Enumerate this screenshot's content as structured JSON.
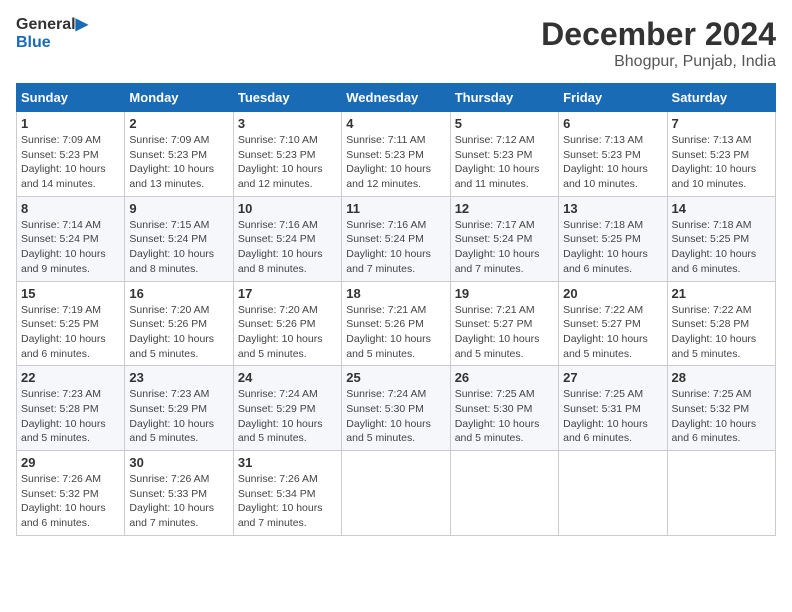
{
  "header": {
    "logo_line1": "General",
    "logo_line2": "Blue",
    "month": "December 2024",
    "location": "Bhogpur, Punjab, India"
  },
  "weekdays": [
    "Sunday",
    "Monday",
    "Tuesday",
    "Wednesday",
    "Thursday",
    "Friday",
    "Saturday"
  ],
  "weeks": [
    [
      {
        "day": "1",
        "sunrise": "Sunrise: 7:09 AM",
        "sunset": "Sunset: 5:23 PM",
        "daylight": "Daylight: 10 hours and 14 minutes."
      },
      {
        "day": "2",
        "sunrise": "Sunrise: 7:09 AM",
        "sunset": "Sunset: 5:23 PM",
        "daylight": "Daylight: 10 hours and 13 minutes."
      },
      {
        "day": "3",
        "sunrise": "Sunrise: 7:10 AM",
        "sunset": "Sunset: 5:23 PM",
        "daylight": "Daylight: 10 hours and 12 minutes."
      },
      {
        "day": "4",
        "sunrise": "Sunrise: 7:11 AM",
        "sunset": "Sunset: 5:23 PM",
        "daylight": "Daylight: 10 hours and 12 minutes."
      },
      {
        "day": "5",
        "sunrise": "Sunrise: 7:12 AM",
        "sunset": "Sunset: 5:23 PM",
        "daylight": "Daylight: 10 hours and 11 minutes."
      },
      {
        "day": "6",
        "sunrise": "Sunrise: 7:13 AM",
        "sunset": "Sunset: 5:23 PM",
        "daylight": "Daylight: 10 hours and 10 minutes."
      },
      {
        "day": "7",
        "sunrise": "Sunrise: 7:13 AM",
        "sunset": "Sunset: 5:23 PM",
        "daylight": "Daylight: 10 hours and 10 minutes."
      }
    ],
    [
      {
        "day": "8",
        "sunrise": "Sunrise: 7:14 AM",
        "sunset": "Sunset: 5:24 PM",
        "daylight": "Daylight: 10 hours and 9 minutes."
      },
      {
        "day": "9",
        "sunrise": "Sunrise: 7:15 AM",
        "sunset": "Sunset: 5:24 PM",
        "daylight": "Daylight: 10 hours and 8 minutes."
      },
      {
        "day": "10",
        "sunrise": "Sunrise: 7:16 AM",
        "sunset": "Sunset: 5:24 PM",
        "daylight": "Daylight: 10 hours and 8 minutes."
      },
      {
        "day": "11",
        "sunrise": "Sunrise: 7:16 AM",
        "sunset": "Sunset: 5:24 PM",
        "daylight": "Daylight: 10 hours and 7 minutes."
      },
      {
        "day": "12",
        "sunrise": "Sunrise: 7:17 AM",
        "sunset": "Sunset: 5:24 PM",
        "daylight": "Daylight: 10 hours and 7 minutes."
      },
      {
        "day": "13",
        "sunrise": "Sunrise: 7:18 AM",
        "sunset": "Sunset: 5:25 PM",
        "daylight": "Daylight: 10 hours and 6 minutes."
      },
      {
        "day": "14",
        "sunrise": "Sunrise: 7:18 AM",
        "sunset": "Sunset: 5:25 PM",
        "daylight": "Daylight: 10 hours and 6 minutes."
      }
    ],
    [
      {
        "day": "15",
        "sunrise": "Sunrise: 7:19 AM",
        "sunset": "Sunset: 5:25 PM",
        "daylight": "Daylight: 10 hours and 6 minutes."
      },
      {
        "day": "16",
        "sunrise": "Sunrise: 7:20 AM",
        "sunset": "Sunset: 5:26 PM",
        "daylight": "Daylight: 10 hours and 5 minutes."
      },
      {
        "day": "17",
        "sunrise": "Sunrise: 7:20 AM",
        "sunset": "Sunset: 5:26 PM",
        "daylight": "Daylight: 10 hours and 5 minutes."
      },
      {
        "day": "18",
        "sunrise": "Sunrise: 7:21 AM",
        "sunset": "Sunset: 5:26 PM",
        "daylight": "Daylight: 10 hours and 5 minutes."
      },
      {
        "day": "19",
        "sunrise": "Sunrise: 7:21 AM",
        "sunset": "Sunset: 5:27 PM",
        "daylight": "Daylight: 10 hours and 5 minutes."
      },
      {
        "day": "20",
        "sunrise": "Sunrise: 7:22 AM",
        "sunset": "Sunset: 5:27 PM",
        "daylight": "Daylight: 10 hours and 5 minutes."
      },
      {
        "day": "21",
        "sunrise": "Sunrise: 7:22 AM",
        "sunset": "Sunset: 5:28 PM",
        "daylight": "Daylight: 10 hours and 5 minutes."
      }
    ],
    [
      {
        "day": "22",
        "sunrise": "Sunrise: 7:23 AM",
        "sunset": "Sunset: 5:28 PM",
        "daylight": "Daylight: 10 hours and 5 minutes."
      },
      {
        "day": "23",
        "sunrise": "Sunrise: 7:23 AM",
        "sunset": "Sunset: 5:29 PM",
        "daylight": "Daylight: 10 hours and 5 minutes."
      },
      {
        "day": "24",
        "sunrise": "Sunrise: 7:24 AM",
        "sunset": "Sunset: 5:29 PM",
        "daylight": "Daylight: 10 hours and 5 minutes."
      },
      {
        "day": "25",
        "sunrise": "Sunrise: 7:24 AM",
        "sunset": "Sunset: 5:30 PM",
        "daylight": "Daylight: 10 hours and 5 minutes."
      },
      {
        "day": "26",
        "sunrise": "Sunrise: 7:25 AM",
        "sunset": "Sunset: 5:30 PM",
        "daylight": "Daylight: 10 hours and 5 minutes."
      },
      {
        "day": "27",
        "sunrise": "Sunrise: 7:25 AM",
        "sunset": "Sunset: 5:31 PM",
        "daylight": "Daylight: 10 hours and 6 minutes."
      },
      {
        "day": "28",
        "sunrise": "Sunrise: 7:25 AM",
        "sunset": "Sunset: 5:32 PM",
        "daylight": "Daylight: 10 hours and 6 minutes."
      }
    ],
    [
      {
        "day": "29",
        "sunrise": "Sunrise: 7:26 AM",
        "sunset": "Sunset: 5:32 PM",
        "daylight": "Daylight: 10 hours and 6 minutes."
      },
      {
        "day": "30",
        "sunrise": "Sunrise: 7:26 AM",
        "sunset": "Sunset: 5:33 PM",
        "daylight": "Daylight: 10 hours and 7 minutes."
      },
      {
        "day": "31",
        "sunrise": "Sunrise: 7:26 AM",
        "sunset": "Sunset: 5:34 PM",
        "daylight": "Daylight: 10 hours and 7 minutes."
      },
      null,
      null,
      null,
      null
    ]
  ]
}
